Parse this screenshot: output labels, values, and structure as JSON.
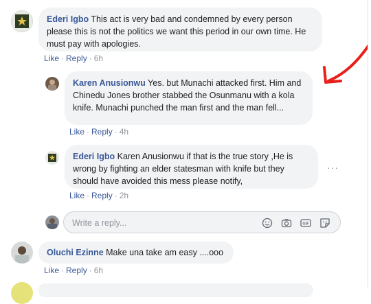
{
  "comments": [
    {
      "author": "Ederi Igbo",
      "text": "This act is very bad and condemned by every person please this is not the politics we want this period in our own time. He must pay with apologies.",
      "like": "Like",
      "reply": "Reply",
      "time": "6h"
    },
    {
      "author": "Karen Anusionwu",
      "text": "Yes. but Munachi attacked first. Him and Chinedu Jones brother stabbed the Osunmanu with a kola knife. Munachi punched the man first and the man fell...",
      "like": "Like",
      "reply": "Reply",
      "time": "4h"
    },
    {
      "author": "Ederi Igbo",
      "text": "Karen Anusionwu if that is the true story ,He is wrong by fighting an elder statesman with knife but they should have avoided this mess please notify,",
      "like": "Like",
      "reply": "Reply",
      "time": "2h"
    },
    {
      "author": "Oluchi Ezinne",
      "text": "Make una take am easy ....ooo",
      "like": "Like",
      "reply": "Reply",
      "time": "6h"
    }
  ],
  "reply_box": {
    "placeholder": "Write a reply..."
  },
  "more_options": "···",
  "icons": [
    "emoji-icon",
    "camera-icon",
    "gif-icon",
    "sticker-icon"
  ],
  "annotation_color": "#e8201b"
}
